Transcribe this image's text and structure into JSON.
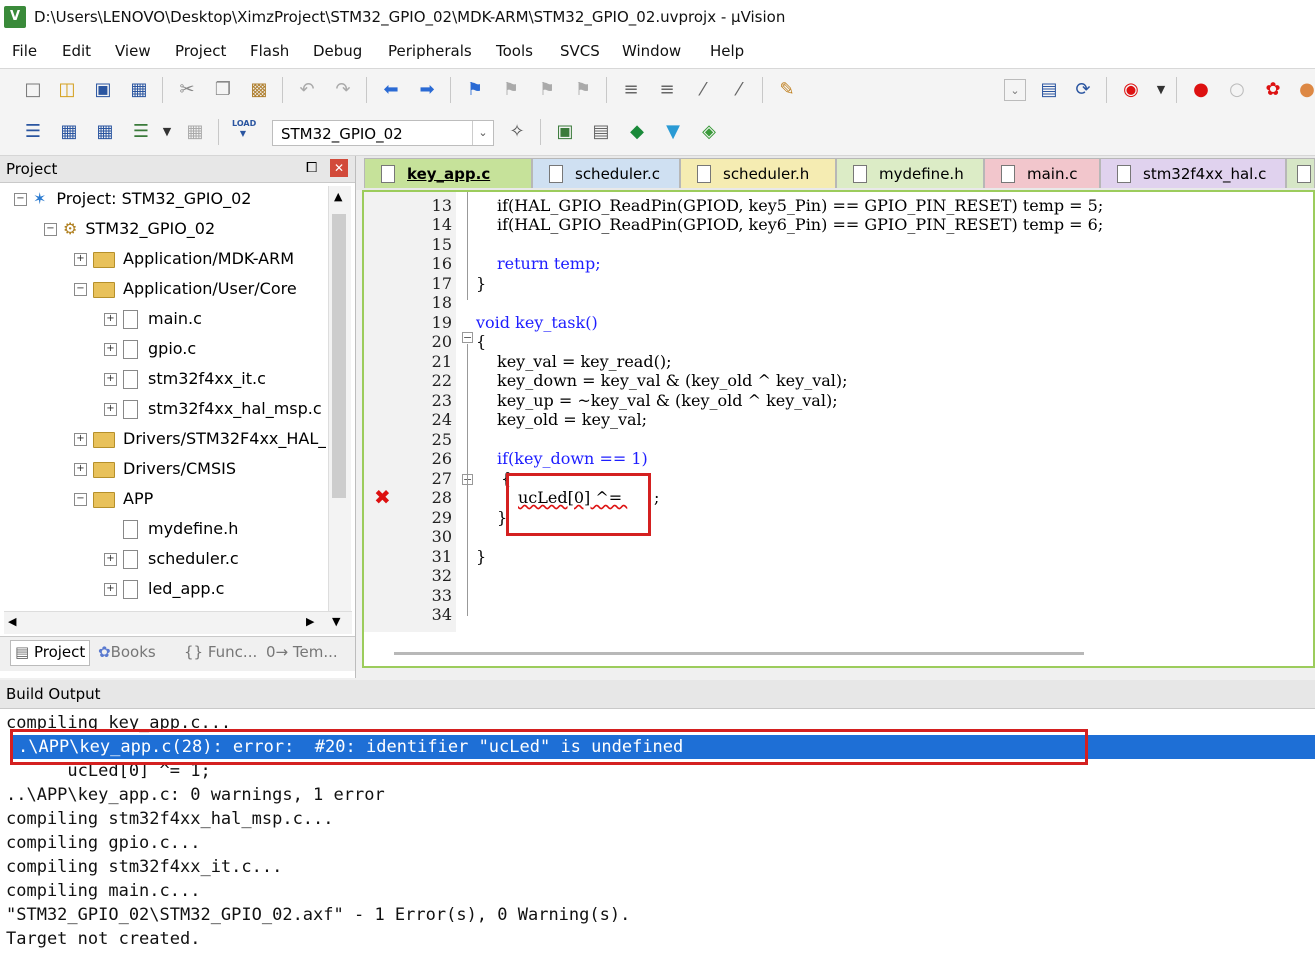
{
  "window": {
    "title": "D:\\Users\\LENOVO\\Desktop\\XimzProject\\STM32_GPIO_02\\MDK-ARM\\STM32_GPIO_02.uvprojx - µVision",
    "app_icon": "V"
  },
  "menu": [
    "File",
    "Edit",
    "View",
    "Project",
    "Flash",
    "Debug",
    "Peripherals",
    "Tools",
    "SVCS",
    "Window",
    "Help"
  ],
  "toolbar": {
    "target_name": "STM32_GPIO_02",
    "load_label": "LOAD"
  },
  "project_panel": {
    "title": "Project",
    "tree": [
      "Project: STM32_GPIO_02",
      "STM32_GPIO_02",
      "Application/MDK-ARM",
      "Application/User/Core",
      "main.c",
      "gpio.c",
      "stm32f4xx_it.c",
      "stm32f4xx_hal_msp.c",
      "Drivers/STM32F4xx_HAL_",
      "Drivers/CMSIS",
      "APP",
      "mydefine.h",
      "scheduler.c",
      "led_app.c"
    ],
    "tabs": [
      "Project",
      "Books",
      "{} Func...",
      "0→ Tem..."
    ]
  },
  "editor": {
    "tabs": [
      "key_app.c",
      "scheduler.c",
      "scheduler.h",
      "mydefine.h",
      "main.c",
      "stm32f4xx_hal.c"
    ],
    "line_numbers": [
      "13",
      "14",
      "15",
      "16",
      "17",
      "18",
      "19",
      "20",
      "21",
      "22",
      "23",
      "24",
      "25",
      "26",
      "27",
      "28",
      "29",
      "30",
      "31",
      "32",
      "33",
      "34"
    ],
    "code": {
      "l13": "if(HAL_GPIO_ReadPin(GPIOD, key5_Pin) == GPIO_PIN_RESET) temp = 5;",
      "l14": "if(HAL_GPIO_ReadPin(GPIOD, key6_Pin) == GPIO_PIN_RESET) temp = 6;",
      "l16": "return temp;",
      "l17": "}",
      "l19": "void key_task()",
      "l20": "{",
      "l21": "key_val = key_read();",
      "l22": "key_down = key_val & (key_old ^ key_val);",
      "l23": "key_up = ~key_val & (key_old ^ key_val);",
      "l24": "key_old = key_val;",
      "l26": "if(key_down == 1)",
      "l27": "{",
      "l28": "ucLed[0] ^= ",
      "l28_tail": ";",
      "l29": "}",
      "l31": "}"
    },
    "error_mark": "✖"
  },
  "build_output": {
    "title": "Build Output",
    "lines": [
      "compiling key_app.c...",
      ".\\APP\\key_app.c(28): error:  #20: identifier \"ucLed\" is undefined",
      "      ucLed[0] ^= 1;",
      "..\\APP\\key_app.c: 0 warnings, 1 error",
      "compiling stm32f4xx_hal_msp.c...",
      "compiling gpio.c...",
      "compiling stm32f4xx_it.c...",
      "compiling main.c...",
      "\"STM32_GPIO_02\\STM32_GPIO_02.axf\" - 1 Error(s), 0 Warning(s).",
      "Target not created."
    ]
  },
  "colors": {
    "selection": "#1e6fd6",
    "highlight_box": "#d42020",
    "keyword": "#1d1dff",
    "number": "#d03c9f"
  }
}
